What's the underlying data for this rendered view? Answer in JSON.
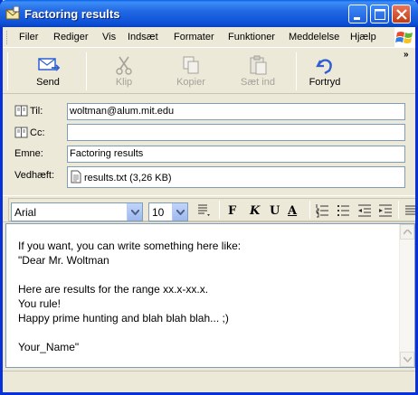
{
  "window": {
    "title": "Factoring results"
  },
  "menu": {
    "items": [
      "Filer",
      "Rediger",
      "Vis",
      "Indsæt",
      "Formater",
      "Funktioner",
      "Meddelelse",
      "Hjælp"
    ]
  },
  "toolbar": {
    "send": "Send",
    "cut": "Klip",
    "copy": "Kopier",
    "paste": "Sæt ind",
    "undo": "Fortryd",
    "overflow": "»"
  },
  "header": {
    "to_label": "Til:",
    "to_value": "woltman@alum.mit.edu",
    "cc_label": "Cc:",
    "cc_value": "",
    "subject_label": "Emne:",
    "subject_value": "Factoring results",
    "attach_label": "Vedhæft:",
    "attach_value": "results.txt (3,26 KB)"
  },
  "format": {
    "font": "Arial",
    "size": "10",
    "bold": "F",
    "italic": "K",
    "underline": "U",
    "color": "A"
  },
  "body": {
    "text": "If you want, you can write something here like:\n\"Dear Mr. Woltman\n\nHere are results for the range xx.x-xx.x.\nYou rule!\nHappy prime hunting and blah blah blah... ;)\n\nYour_Name\""
  },
  "colors": {
    "titlebar": "#0a5ee8",
    "undo_icon": "#2f5fd0",
    "send_icon": "#2f5fd0"
  }
}
